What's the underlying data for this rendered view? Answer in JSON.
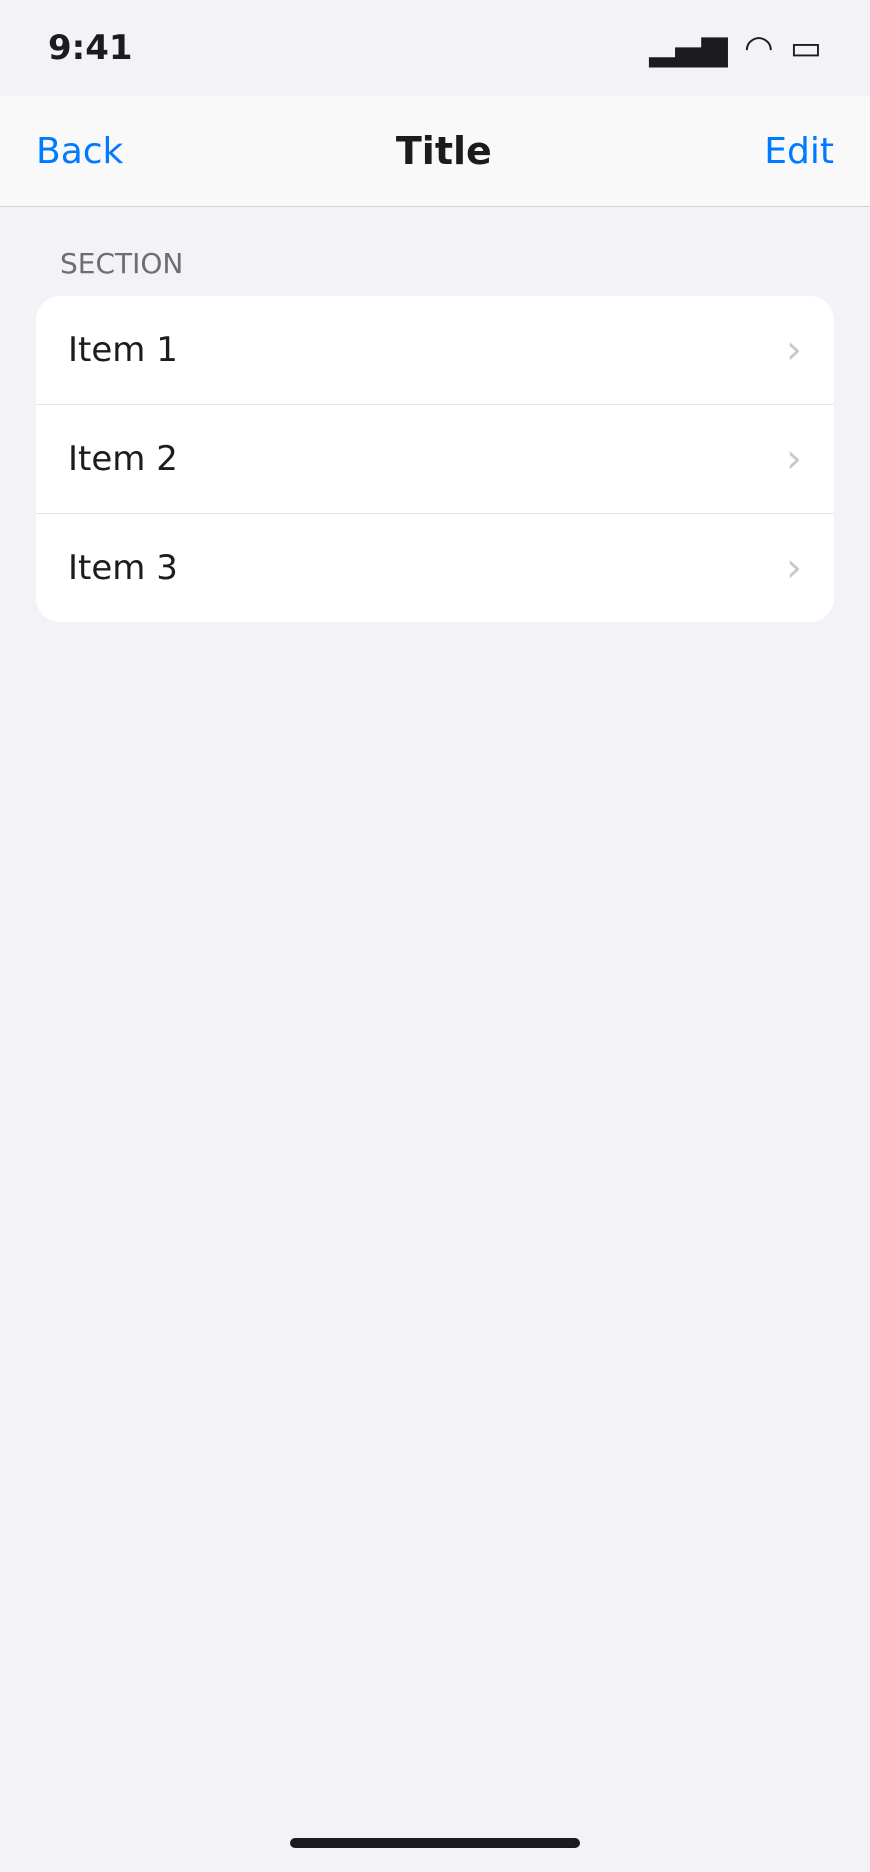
{
  "status_bar": {
    "time": "9:41",
    "signal_icon": "signal-icon",
    "wifi_icon": "wifi-icon",
    "battery_icon": "battery-icon"
  },
  "nav": {
    "back_label": "Back",
    "title": "Title",
    "action_label": "Edit"
  },
  "section": {
    "header": "SECTION"
  },
  "items": [
    {
      "label": "Item 1"
    },
    {
      "label": "Item 2"
    },
    {
      "label": "Item 3"
    }
  ],
  "colors": {
    "accent": "#007aff"
  }
}
